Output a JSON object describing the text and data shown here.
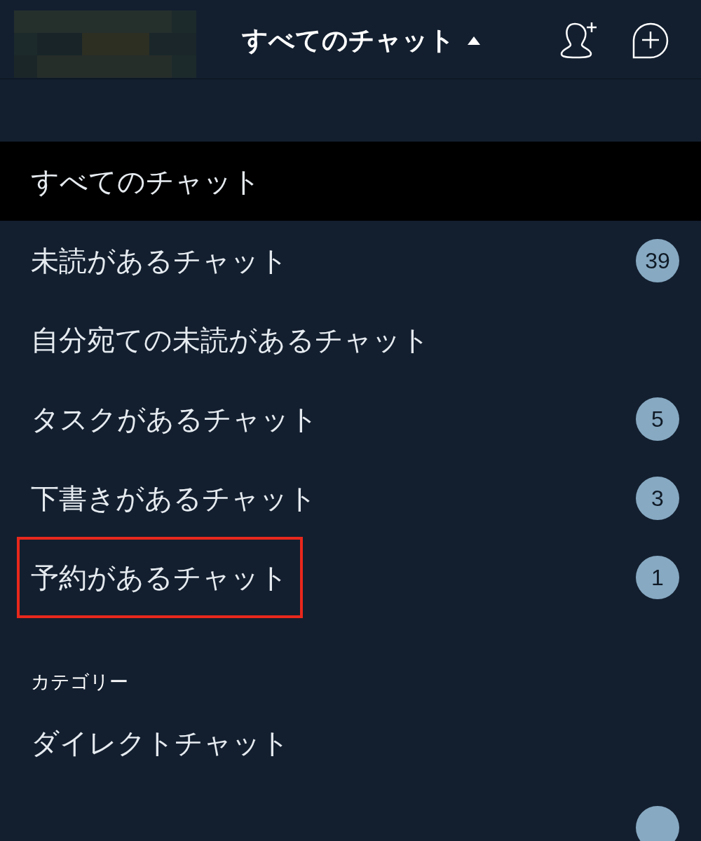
{
  "header": {
    "title": "すべてのチャット",
    "dropdown_expanded": true
  },
  "filters": [
    {
      "label": "すべてのチャット",
      "selected": true,
      "highlighted": false
    },
    {
      "label": "未読があるチャット",
      "count": "39",
      "selected": false,
      "highlighted": false
    },
    {
      "label": "自分宛ての未読があるチャット",
      "selected": false,
      "highlighted": false
    },
    {
      "label": "タスクがあるチャット",
      "count": "5",
      "selected": false,
      "highlighted": false
    },
    {
      "label": "下書きがあるチャット",
      "count": "3",
      "selected": false,
      "highlighted": false
    },
    {
      "label": "予約があるチャット",
      "count": "1",
      "selected": false,
      "highlighted": true
    }
  ],
  "category_section": {
    "title": "カテゴリー",
    "items": [
      {
        "label": "ダイレクトチャット",
        "selected": false
      }
    ]
  }
}
